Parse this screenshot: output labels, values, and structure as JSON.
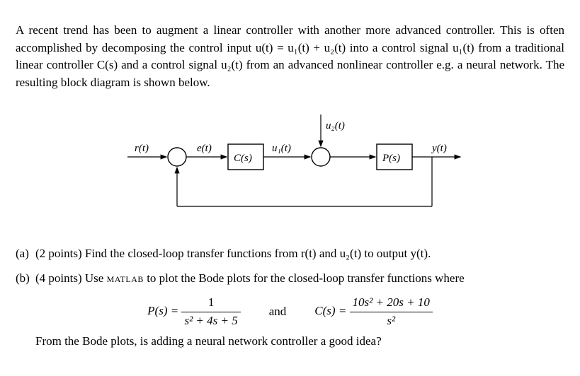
{
  "intro": {
    "text": "A recent trend has been to augment a linear controller with another more advanced controller. This is often accomplished by decomposing the control input u(t) = u₁(t) + u₂(t) into a control signal u₁(t) from a traditional linear controller C(s) and a control signal u₂(t) from an advanced nonlinear controller e.g. a neural network. The resulting block diagram is shown below."
  },
  "diagram": {
    "r": "r(t)",
    "e": "e(t)",
    "C": "C(s)",
    "u1": "u₁(t)",
    "u2": "u₂(t)",
    "P": "P(s)",
    "y": "y(t)"
  },
  "parts": {
    "a_label": "(a)",
    "a_points": "(2 points)",
    "a_text": "Find the closed-loop transfer functions from r(t) and u₂(t) to output y(t).",
    "b_label": "(b)",
    "b_points": "(4 points)",
    "b_text_pre": "Use ",
    "b_matlab": "matlab",
    "b_text_post": " to plot the Bode plots for the closed-loop transfer functions where",
    "b_followup": "From the Bode plots, is adding a neural network controller a good idea?"
  },
  "eqs": {
    "P_lhs": "P(s) = ",
    "P_num": "1",
    "P_den": "s² + 4s + 5",
    "and": "and",
    "C_lhs": "C(s) = ",
    "C_num": "10s² + 20s + 10",
    "C_den": "s²"
  }
}
